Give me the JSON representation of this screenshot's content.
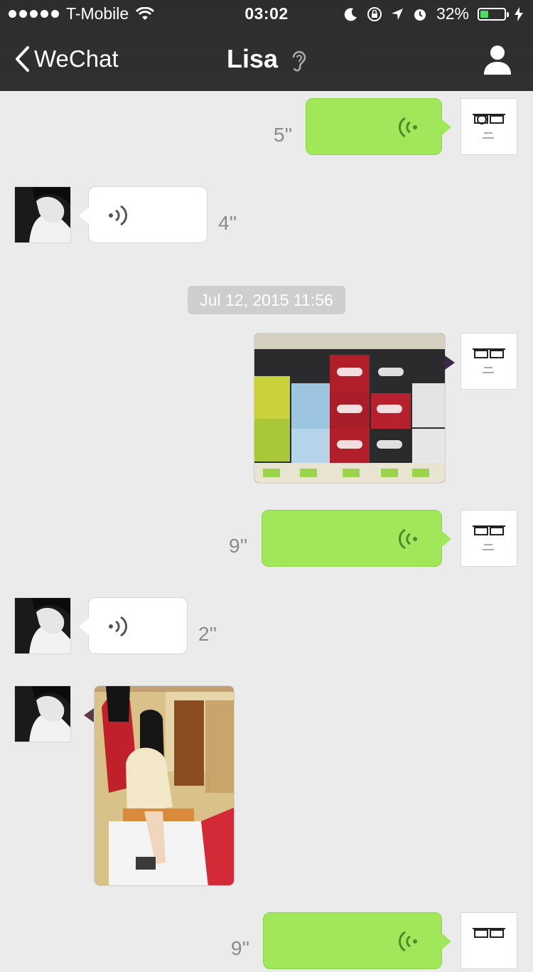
{
  "status_bar": {
    "carrier": "T-Mobile",
    "time": "03:02",
    "battery": "32%",
    "battery_level": 0.32,
    "icons": [
      "signal-dots-icon",
      "wifi-icon",
      "moon-icon",
      "rotation-lock-icon",
      "location-arrow-icon",
      "alarm-icon",
      "battery-icon",
      "charging-bolt-icon"
    ]
  },
  "nav": {
    "back_label": "WeChat",
    "title": "Lisa",
    "title_icon": "ear-icon",
    "right_icon": "profile-icon"
  },
  "colors": {
    "nav_bg": "#2d2d2f",
    "chat_bg": "#ebebeb",
    "my_bubble": "#a0e75a",
    "their_bubble": "#ffffff",
    "timestamp_bg": "#cecece"
  },
  "messages": [
    {
      "sender": "me",
      "type": "voice",
      "duration": "5''"
    },
    {
      "sender": "Lisa",
      "type": "voice",
      "duration": "4''"
    },
    {
      "type": "timestamp",
      "text": "Jul 12, 2015 11:56"
    },
    {
      "sender": "me",
      "type": "image",
      "content": "store shelf with Dr Pepper, Fresca and Fuze boxes"
    },
    {
      "sender": "me",
      "type": "voice",
      "duration": "9''"
    },
    {
      "sender": "Lisa",
      "type": "voice",
      "duration": "2''"
    },
    {
      "sender": "Lisa",
      "type": "image",
      "content": "woman seated at a foot spa"
    },
    {
      "sender": "me",
      "type": "voice",
      "duration": "9''"
    }
  ]
}
